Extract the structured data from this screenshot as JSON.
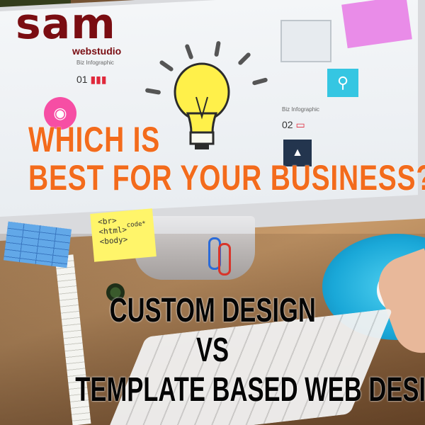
{
  "logo": {
    "brand": "sam",
    "sub": "webstudio",
    "color": "#7a0d12"
  },
  "screen": {
    "label_one": "Biz Infographic",
    "number_one": "01",
    "label_two": "Biz Infographic",
    "number_two": "02",
    "icons": [
      "camera-icon",
      "search-icon",
      "rocket-icon",
      "lightbulb-icon"
    ]
  },
  "sticky_note": {
    "lines": [
      "<br>",
      "<html>",
      "<body>",
      "code*"
    ]
  },
  "headline": {
    "line1": "WHICH IS",
    "line2": "BEST FOR YOUR BUSINESS??",
    "color": "#f36b1c"
  },
  "comparison": {
    "line1": "CUSTOM DESIGN",
    "line2": "VS",
    "line3": "TEMPLATE BASED WEB DESIGN",
    "color": "#050505"
  }
}
